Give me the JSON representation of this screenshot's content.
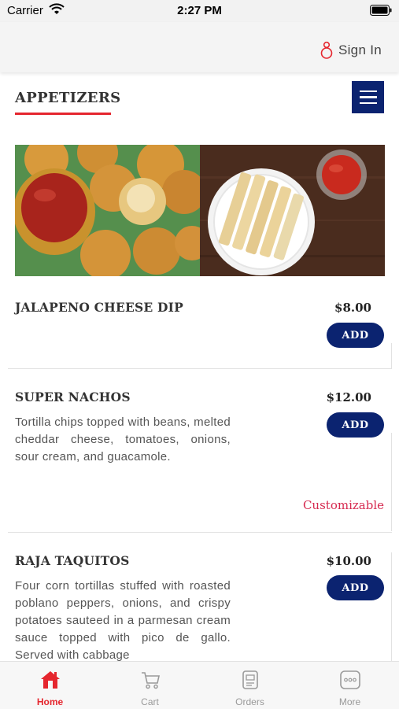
{
  "status_bar": {
    "carrier": "Carrier",
    "time": "2:27 PM"
  },
  "header": {
    "sign_in_label": "Sign In"
  },
  "category": {
    "title": "APPETIZERS"
  },
  "items": [
    {
      "name": "JALAPENO CHEESE DIP",
      "price": "$8.00",
      "add_label": "ADD"
    },
    {
      "name": "SUPER NACHOS",
      "price": "$12.00",
      "add_label": "ADD",
      "description": "Tortilla chips topped with beans, melted cheddar cheese, tomatoes, onions, sour cream, and guacamole.",
      "customizable_label": "Customizable"
    },
    {
      "name": "RAJA TAQUITOS",
      "price": "$10.00",
      "add_label": "ADD",
      "description": "Four corn tortillas stuffed with roasted poblano peppers, onions, and crispy potatoes sauteed in a parmesan cream sauce topped with pico de gallo. Served with cabbage"
    }
  ],
  "tabs": [
    {
      "label": "Home",
      "icon": "home-icon",
      "active": true
    },
    {
      "label": "Cart",
      "icon": "cart-icon",
      "active": false
    },
    {
      "label": "Orders",
      "icon": "orders-icon",
      "active": false
    },
    {
      "label": "More",
      "icon": "more-icon",
      "active": false
    }
  ],
  "colors": {
    "accent_red": "#e5262e",
    "navy": "#0b2370",
    "customizable_pink": "#d6294f"
  }
}
